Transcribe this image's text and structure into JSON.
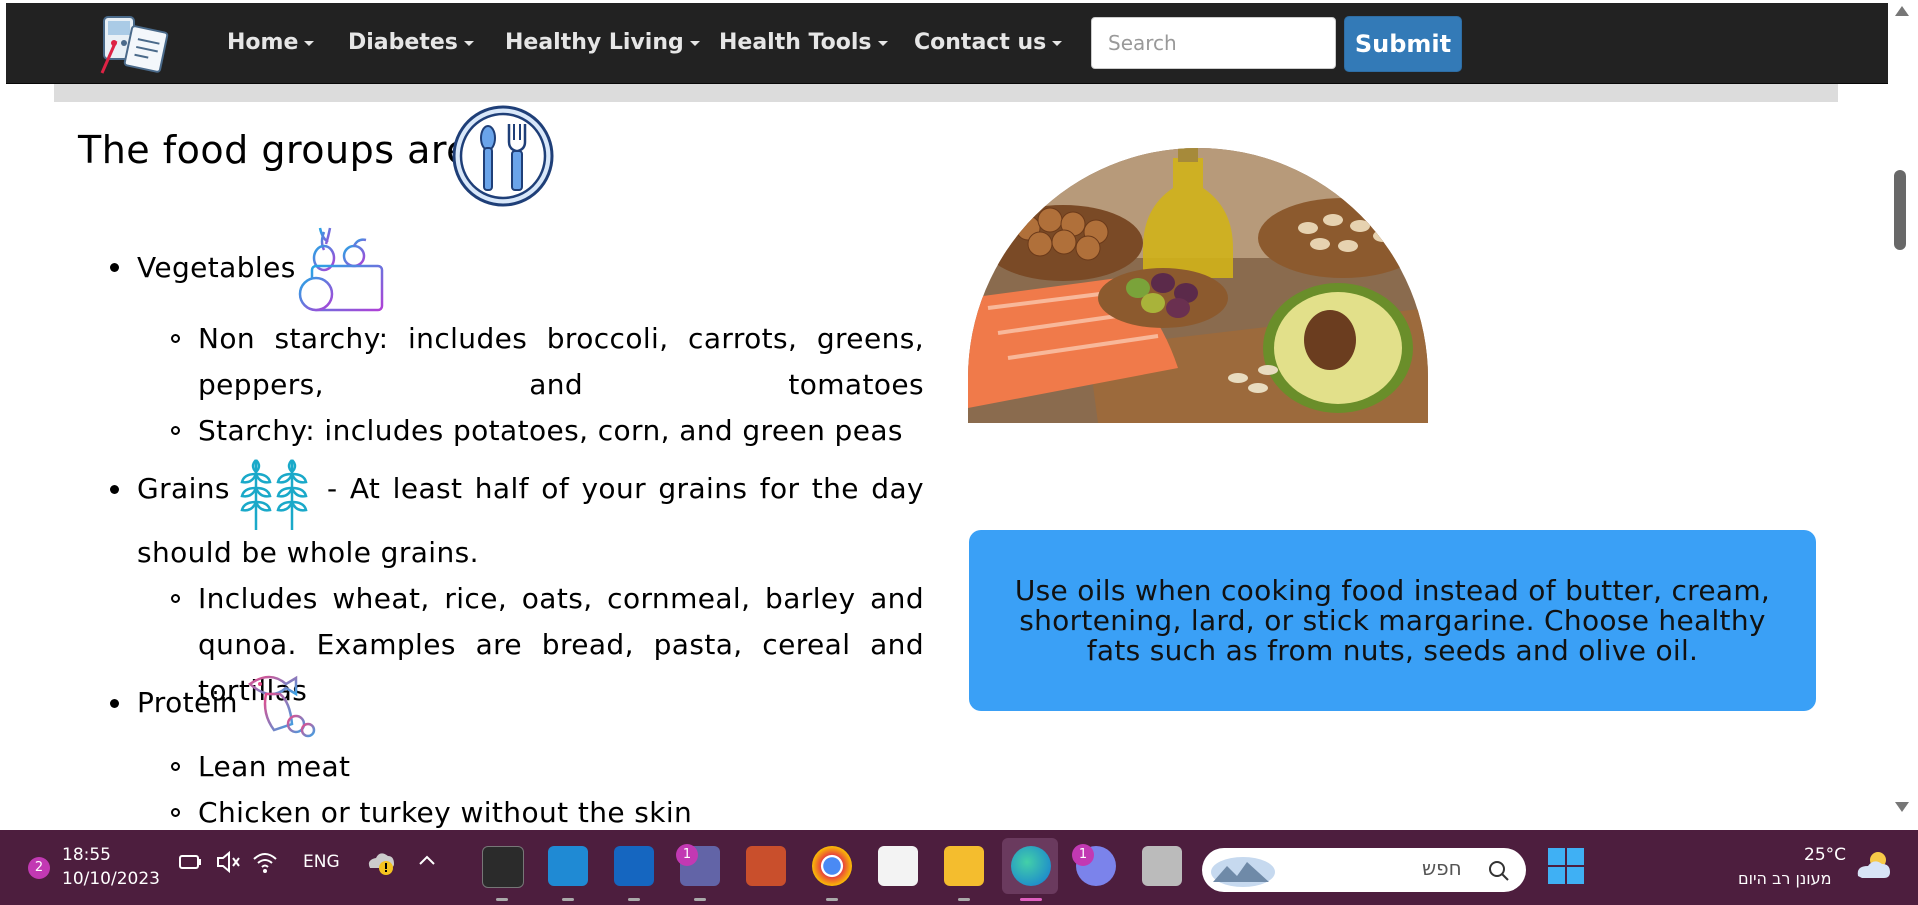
{
  "navbar": {
    "items": [
      {
        "label": "Home"
      },
      {
        "label": "Diabetes"
      },
      {
        "label": "Healthy Living"
      },
      {
        "label": "Health Tools"
      },
      {
        "label": "Contact us"
      }
    ],
    "search_placeholder": "Search",
    "submit_label": "Submit"
  },
  "main": {
    "heading": "The food groups are:",
    "groups": [
      {
        "name": "Vegetables",
        "subitems": [
          "Non starchy: includes broccoli, carrots, greens, peppers, and tomatoes",
          "Starchy: includes potatoes, corn, and green peas"
        ]
      },
      {
        "name": "Grains",
        "note": "- At least half of your grains for the day should be whole grains.",
        "subitems": [
          "Includes wheat, rice, oats, cornmeal, barley and qunoa. Examples are bread, pasta, cereal and tortillas"
        ]
      },
      {
        "name": "Protein",
        "subitems": [
          "Lean meat",
          "Chicken or turkey without the skin"
        ]
      }
    ],
    "tip": "Use oils when cooking food instead of butter, cream, shortening, lard, or stick margarine. Choose healthy fats such as from nuts, seeds and olive oil."
  },
  "taskbar": {
    "notification_count": "2",
    "time": "18:55",
    "date": "10/10/2023",
    "language": "ENG",
    "search_placeholder": "חפש",
    "weather_temp": "25°C",
    "weather_desc": "מעונן רב היום",
    "teams_badge": "1",
    "chat_badge": "1"
  },
  "colors": {
    "navbar_bg": "#222222",
    "submit_bg": "#337ab7",
    "tip_bg": "#3aa0f6",
    "taskbar_bg": "#4d1e3e"
  }
}
